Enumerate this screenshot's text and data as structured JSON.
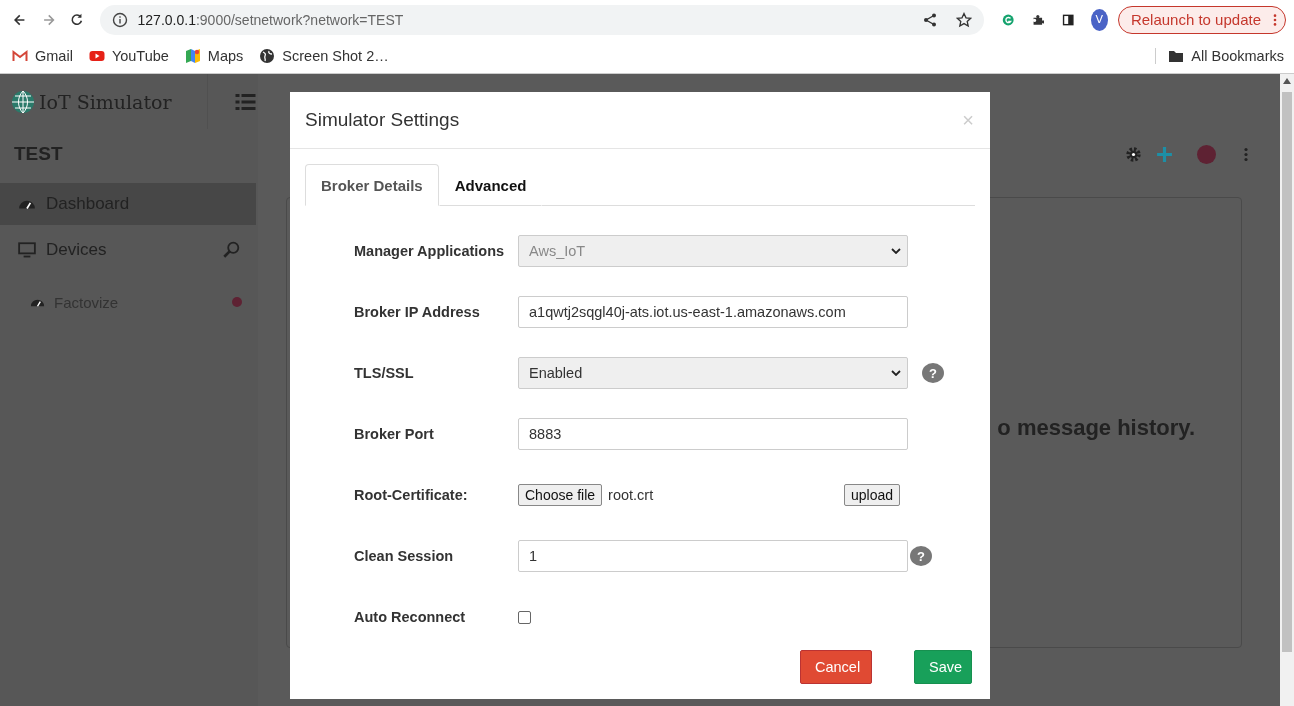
{
  "browser": {
    "url_host": "127.0.0.1",
    "url_rest": ":9000/setnetwork?network=TEST",
    "relaunch": "Relaunch to update",
    "avatar": "V",
    "bookmarks": [
      {
        "label": "Gmail",
        "kind": "gmail"
      },
      {
        "label": "YouTube",
        "kind": "youtube"
      },
      {
        "label": "Maps",
        "kind": "maps"
      },
      {
        "label": "Screen Shot 2…",
        "kind": "globe"
      }
    ],
    "all_bookmarks": "All Bookmarks"
  },
  "app": {
    "logo": "IoT Simulator",
    "network": "TEST",
    "sidebar": [
      {
        "label": "Dashboard",
        "kind": "dashboard",
        "selected": true
      },
      {
        "label": "Devices",
        "kind": "devices",
        "selected": false
      }
    ],
    "devices": [
      {
        "name": "Factovize",
        "color": "#5e2233"
      }
    ],
    "message": "o message history."
  },
  "modal": {
    "title": "Simulator Settings",
    "close": "×",
    "tabs": [
      {
        "label": "Broker Details",
        "selected": true
      },
      {
        "label": "Advanced",
        "selected": false
      }
    ],
    "fields": [
      {
        "label": "Manager Applications",
        "kind": "select",
        "value": "Aws_IoT",
        "disabled": true
      },
      {
        "label": "Broker IP Address",
        "kind": "text",
        "value": "a1qwtj2sqgl40j-ats.iot.us-east-1.amazonaws.com"
      },
      {
        "label": "TLS/SSL",
        "kind": "select",
        "value": "Enabled",
        "disabled": false,
        "help": "?"
      },
      {
        "label": "Broker Port",
        "kind": "text",
        "value": "8883"
      },
      {
        "label": "Root-Certificate:",
        "kind": "file",
        "button": "Choose file",
        "filename": "root.crt",
        "upload": "upload"
      },
      {
        "label": "Clean Session",
        "kind": "text",
        "value": "1",
        "help": "?"
      },
      {
        "label": "Auto Reconnect",
        "kind": "checkbox",
        "checked": false
      }
    ],
    "cancel": "Cancel",
    "save": "Save"
  }
}
